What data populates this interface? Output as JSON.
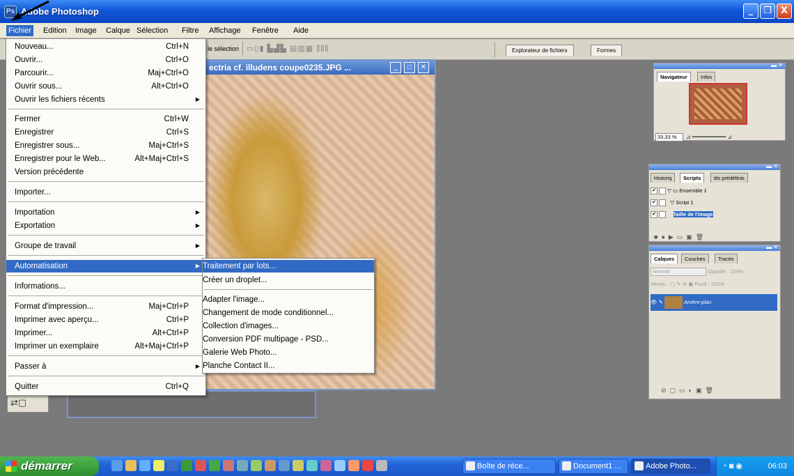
{
  "window": {
    "title": "Adobe Photoshop",
    "icon": "photoshop-icon",
    "buttons": [
      "_",
      "❐",
      "X"
    ]
  },
  "menubar": [
    "Fichier",
    "Edition",
    "Image",
    "Calque",
    "Sélection",
    "Filtre",
    "Affichage",
    "Fenêtre",
    "Aide"
  ],
  "options_bar": {
    "label": "le sélection",
    "well_tabs": [
      "Explorateur de fichiers",
      "Formes"
    ]
  },
  "canvas_window": {
    "title": "ectria cf. illudens coupe0235.JPG ..."
  },
  "fichier_menu": {
    "items": [
      {
        "label": "Nouveau...",
        "shortcut": "Ctrl+N"
      },
      {
        "label": "Ouvrir...",
        "shortcut": "Ctrl+O"
      },
      {
        "label": "Parcourir...",
        "shortcut": "Maj+Ctrl+O"
      },
      {
        "label": "Ouvrir sous...",
        "shortcut": "Alt+Ctrl+O"
      },
      {
        "label": "Ouvrir les fichiers récents",
        "shortcut": ""
      },
      {
        "label": "Fermer",
        "shortcut": "Ctrl+W"
      },
      {
        "label": "Enregistrer",
        "shortcut": "Ctrl+S"
      },
      {
        "label": "Enregistrer sous...",
        "shortcut": "Maj+Ctrl+S"
      },
      {
        "label": "Enregistrer pour le Web...",
        "shortcut": "Alt+Maj+Ctrl+S"
      },
      {
        "label": "Version précédente",
        "shortcut": ""
      },
      {
        "label": "Importer...",
        "shortcut": ""
      },
      {
        "label": "Importation",
        "shortcut": ""
      },
      {
        "label": "Exportation",
        "shortcut": ""
      },
      {
        "label": "Groupe de travail",
        "shortcut": ""
      },
      {
        "label": "Automatisation",
        "shortcut": ""
      },
      {
        "label": "Informations...",
        "shortcut": ""
      },
      {
        "label": "Format d'impression...",
        "shortcut": "Maj+Ctrl+P"
      },
      {
        "label": "Imprimer avec aperçu...",
        "shortcut": "Ctrl+P"
      },
      {
        "label": "Imprimer...",
        "shortcut": "Alt+Ctrl+P"
      },
      {
        "label": "Imprimer un exemplaire",
        "shortcut": "Alt+Maj+Ctrl+P"
      },
      {
        "label": "Passer à",
        "shortcut": ""
      },
      {
        "label": "Quitter",
        "shortcut": "Ctrl+Q"
      }
    ]
  },
  "automatisation_submenu": [
    "Traitement par lots...",
    "Créer un droplet...",
    "Adapter l'image...",
    "Changement de mode conditionnel...",
    "Collection d'images...",
    "Conversion PDF multipage - PSD...",
    "Galerie Web Photo...",
    "Planche Contact II..."
  ],
  "navigator_panel": {
    "tabs": [
      "Navigateur",
      "Infos"
    ],
    "zoom": "33,33 %"
  },
  "scripts_panel": {
    "tabs": [
      "Historiq",
      "Scripts",
      "tils prédéfinis"
    ],
    "rows": [
      "Ensemble 1",
      "Script 1",
      "Taille de l'image"
    ]
  },
  "layers_panel": {
    "tabs": [
      "Calques",
      "Couches",
      "Tracés"
    ],
    "mode": "Normal",
    "opacity_label": "Opacité :",
    "opacity_value": "100%",
    "lock_label": "Verrou :",
    "fill_label": "Fond :",
    "fill_value": "100%",
    "layer_name": "Arrière-plan"
  },
  "taskbar": {
    "start_label": "démarrer",
    "tasks": [
      "Boîte de réce...",
      "Document1 ...",
      "Adobe Photo..."
    ],
    "clock": "06:03"
  },
  "colors": {
    "menu_highlight": "#316ac5",
    "title_blue": "#0a46c4",
    "start_green": "#2f8e2f"
  }
}
